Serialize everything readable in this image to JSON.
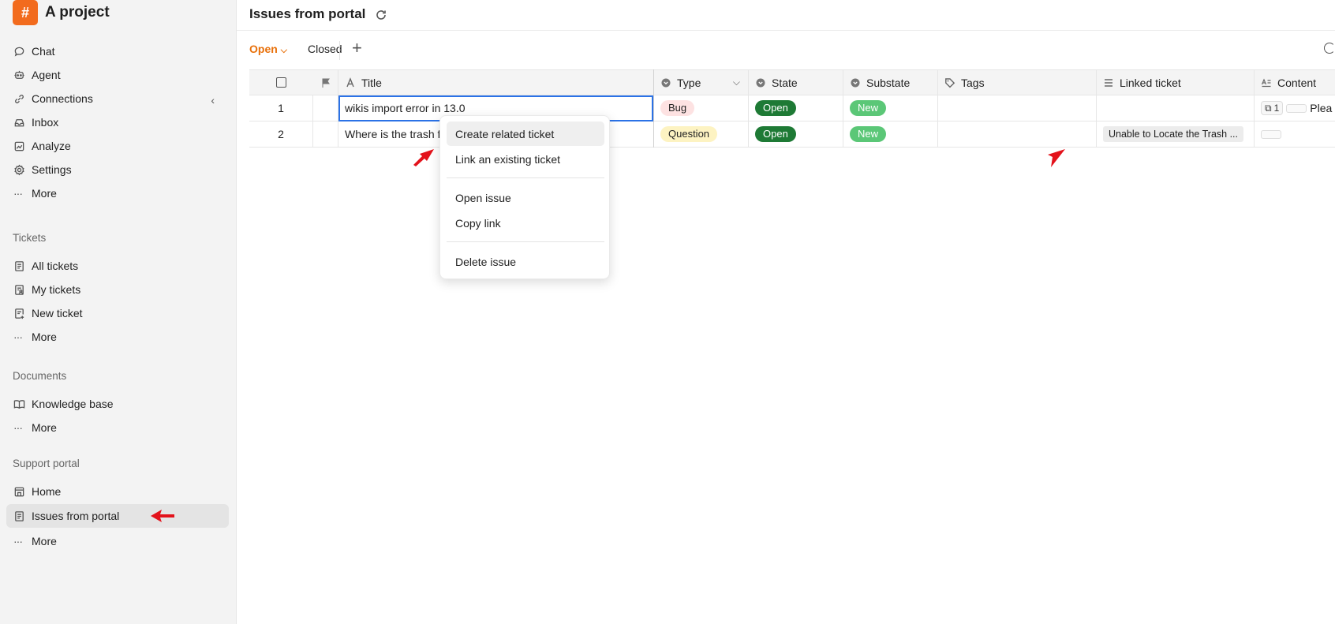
{
  "app": {
    "logo_glyph": "#",
    "project_name": "A project",
    "accent_color": "#f26b1d"
  },
  "sidebar": {
    "items": [
      {
        "label": "Chat",
        "icon": "chat-icon"
      },
      {
        "label": "Agent",
        "icon": "agent-icon"
      },
      {
        "label": "Connections",
        "icon": "connections-icon"
      },
      {
        "label": "Inbox",
        "icon": "inbox-icon"
      },
      {
        "label": "Analyze",
        "icon": "analyze-icon"
      },
      {
        "label": "Settings",
        "icon": "gear-icon"
      },
      {
        "label": "More",
        "icon": "more-icon"
      }
    ],
    "tickets_label": "Tickets",
    "tickets": [
      {
        "label": "All tickets"
      },
      {
        "label": "My tickets"
      },
      {
        "label": "New ticket"
      },
      {
        "label": "More"
      }
    ],
    "documents_label": "Documents",
    "documents": [
      {
        "label": "Knowledge base"
      },
      {
        "label": "More"
      }
    ],
    "portal_label": "Support portal",
    "portal": [
      {
        "label": "Home"
      },
      {
        "label": "Issues from portal"
      },
      {
        "label": "More"
      }
    ]
  },
  "header": {
    "title": "Issues from portal"
  },
  "tabs": {
    "open": "Open",
    "closed": "Closed",
    "add": "+"
  },
  "table": {
    "columns": [
      "Title",
      "Type",
      "State",
      "Substate",
      "Tags",
      "Linked ticket",
      "Content"
    ],
    "rows": [
      {
        "num": "1",
        "title": "wikis import error in 13.0",
        "type": "Bug",
        "state": "Open",
        "substate": "New",
        "tags": "",
        "linked": "",
        "content_count": "1",
        "content_text": "Plea"
      },
      {
        "num": "2",
        "title": "Where is the trash f",
        "type": "Question",
        "state": "Open",
        "substate": "New",
        "tags": "",
        "linked": "Unable to Locate the Trash ...",
        "content_count": "",
        "content_text": ""
      }
    ]
  },
  "context_menu": {
    "items": [
      "Create related ticket",
      "Link an existing ticket",
      "Open issue",
      "Copy link",
      "Delete issue"
    ]
  },
  "colors": {
    "open_tab": "#e8700a",
    "state_open": "#1e7a35",
    "substate_new": "#5bc777",
    "bug": "#fde2e2",
    "question": "#fdf3c2",
    "annotation_arrow": "#e3121b"
  }
}
